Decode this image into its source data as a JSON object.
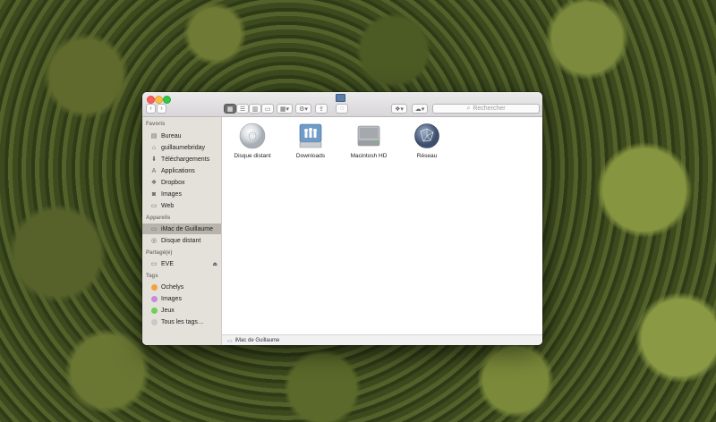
{
  "toolbar": {
    "view_icon": "icon-view-icon",
    "view_list": "list-view-icon",
    "view_columns": "column-view-icon",
    "view_coverflow": "coverflow-view-icon",
    "search_placeholder": "Rechercher"
  },
  "sidebar": {
    "favorites_title": "Favoris",
    "favorites": [
      {
        "label": "Bureau",
        "icon": "desktop-icon"
      },
      {
        "label": "guillaumebriday",
        "icon": "home-icon"
      },
      {
        "label": "Téléchargements",
        "icon": "download-icon"
      },
      {
        "label": "Applications",
        "icon": "applications-icon"
      },
      {
        "label": "Dropbox",
        "icon": "dropbox-icon"
      },
      {
        "label": "Images",
        "icon": "camera-icon"
      },
      {
        "label": "Web",
        "icon": "folder-icon"
      }
    ],
    "devices_title": "Appareils",
    "devices": [
      {
        "label": "iMac de Guillaume",
        "icon": "imac-icon",
        "selected": true
      },
      {
        "label": "Disque distant",
        "icon": "disc-icon"
      }
    ],
    "shared_title": "Partagé(e)",
    "shared": [
      {
        "label": "EVE",
        "icon": "network-computer-icon"
      }
    ],
    "tags_title": "Tags",
    "tags": [
      {
        "label": "Ochelys",
        "color": "#f5a13c"
      },
      {
        "label": "Images",
        "color": "#c68ae0"
      },
      {
        "label": "Jeux",
        "color": "#6fcf57"
      },
      {
        "label": "Tous les tags…",
        "color": "#c8c8c8"
      }
    ]
  },
  "content": {
    "items": [
      {
        "label": "Disque distant",
        "icon": "cd-disc-icon"
      },
      {
        "label": "Downloads",
        "icon": "shared-drive-icon"
      },
      {
        "label": "Macintosh HD",
        "icon": "hard-drive-icon"
      },
      {
        "label": "Réseau",
        "icon": "network-globe-icon"
      }
    ]
  },
  "pathbar": {
    "label": "iMac de Guillaume"
  },
  "colors": {
    "sidebar_bg": "#e4e0da",
    "selection": "#b8b4ad",
    "close": "#fc605b",
    "minimize": "#fdbc40",
    "maximize": "#34c84a"
  }
}
